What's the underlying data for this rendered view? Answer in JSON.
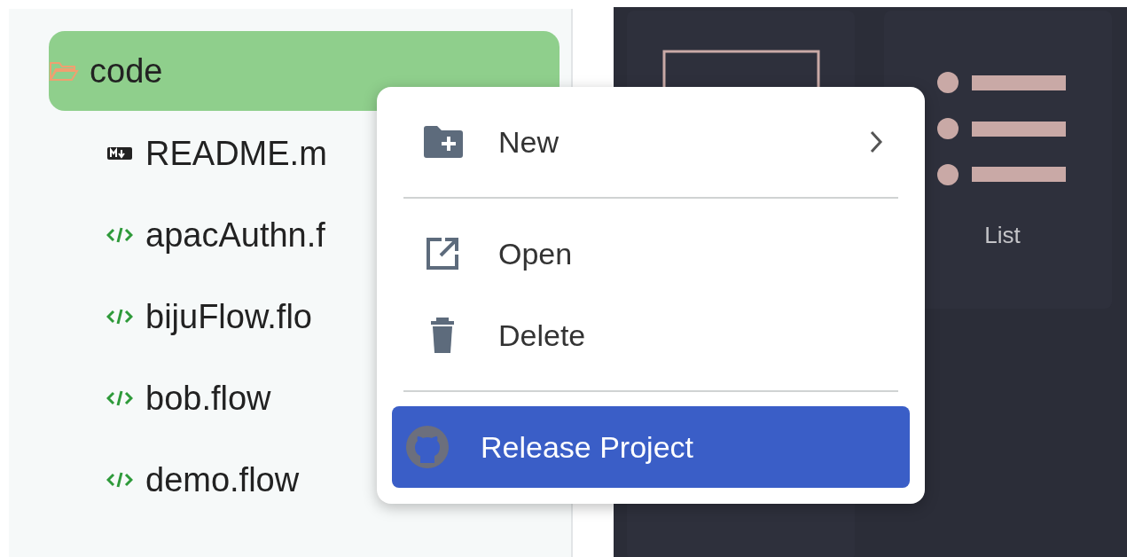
{
  "tree": {
    "folder": {
      "name": "code",
      "selected": true
    },
    "files": [
      {
        "name": "README.m",
        "kind": "markdown"
      },
      {
        "name": "apacAuthn.f",
        "kind": "code"
      },
      {
        "name": "bijuFlow.flo",
        "kind": "code"
      },
      {
        "name": "bob.flow",
        "kind": "code"
      },
      {
        "name": "demo.flow",
        "kind": "code"
      }
    ]
  },
  "layouts": [
    {
      "kind": "frame"
    },
    {
      "kind": "list",
      "label": "List"
    }
  ],
  "menu": {
    "items": [
      {
        "kind": "new",
        "label": "New",
        "submenu": true,
        "selected": false
      },
      {
        "kind": "divider"
      },
      {
        "kind": "open",
        "label": "Open",
        "selected": false
      },
      {
        "kind": "delete",
        "label": "Delete",
        "selected": false
      },
      {
        "kind": "divider"
      },
      {
        "kind": "github",
        "label": "Release Project",
        "selected": true
      }
    ]
  }
}
